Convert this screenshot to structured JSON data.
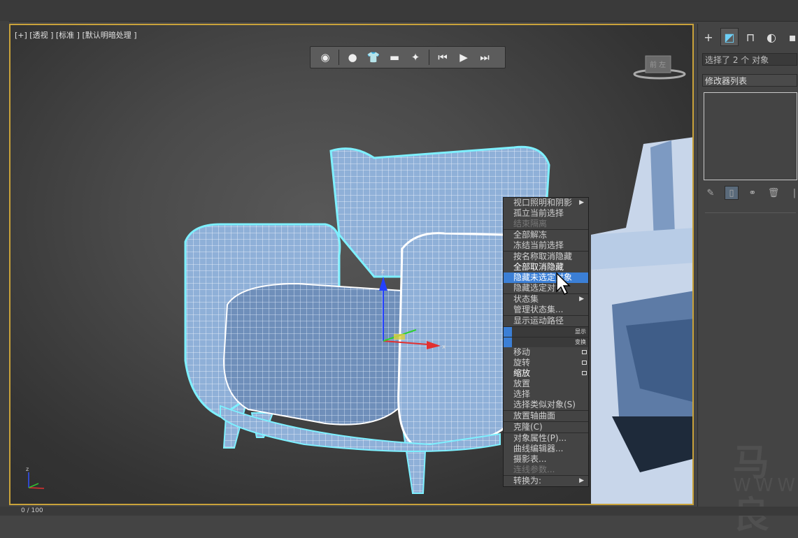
{
  "viewport": {
    "label": "[+] [透视 ] [标准 ] [默认明暗处理 ]",
    "viewcube_label": "前 左"
  },
  "viewport_toolbar": {
    "icons": [
      "viewport-settings-icon",
      "shading-sphere-icon",
      "material-shirt-icon",
      "eraser-icon",
      "light-sparkle-icon",
      "key-prev-icon",
      "play-icon",
      "key-next-icon"
    ]
  },
  "context_menu": {
    "items_top": [
      {
        "label": "视口照明和阴影",
        "submenu": true
      },
      {
        "label": "孤立当前选择"
      },
      {
        "label": "结束隔离",
        "disabled": true
      },
      {
        "label": "全部解冻",
        "sep": true
      },
      {
        "label": "冻结当前选择"
      },
      {
        "label": "按名称取消隐藏",
        "sep": true
      },
      {
        "label": "全部取消隐藏",
        "bright": true
      },
      {
        "label": "隐藏未选定对象",
        "highlighted": true
      },
      {
        "label": "隐藏选定对象"
      },
      {
        "label": "状态集",
        "submenu": true,
        "sep": true
      },
      {
        "label": "管理状态集..."
      },
      {
        "label": "显示运动路径",
        "sep": true
      }
    ],
    "quad_labels": [
      "显示",
      "变换"
    ],
    "items_bottom": [
      {
        "label": "移动",
        "box": true
      },
      {
        "label": "旋转",
        "box": true
      },
      {
        "label": "缩放",
        "box": true,
        "bright": true
      },
      {
        "label": "放置"
      },
      {
        "label": "选择"
      },
      {
        "label": "选择类似对象(S)"
      },
      {
        "label": "放置轴曲面",
        "sep": true
      },
      {
        "label": "克隆(C)",
        "sep": true
      },
      {
        "label": "对象属性(P)...",
        "sep": true
      },
      {
        "label": "曲线编辑器..."
      },
      {
        "label": "摄影表..."
      },
      {
        "label": "连线参数...",
        "disabled": true
      },
      {
        "label": "转换为:",
        "submenu": true,
        "sep": true
      }
    ]
  },
  "command_panel": {
    "selection_text": "选择了 2 个 对象",
    "modifier_list": "修改器列表",
    "tabs": [
      "create-plus-icon",
      "modify-icon",
      "hierarchy-icon",
      "motion-icon",
      "display-icon"
    ]
  },
  "watermark": {
    "line1": "马良",
    "line2": "WWW."
  },
  "status": {
    "frame": "0 / 100"
  }
}
